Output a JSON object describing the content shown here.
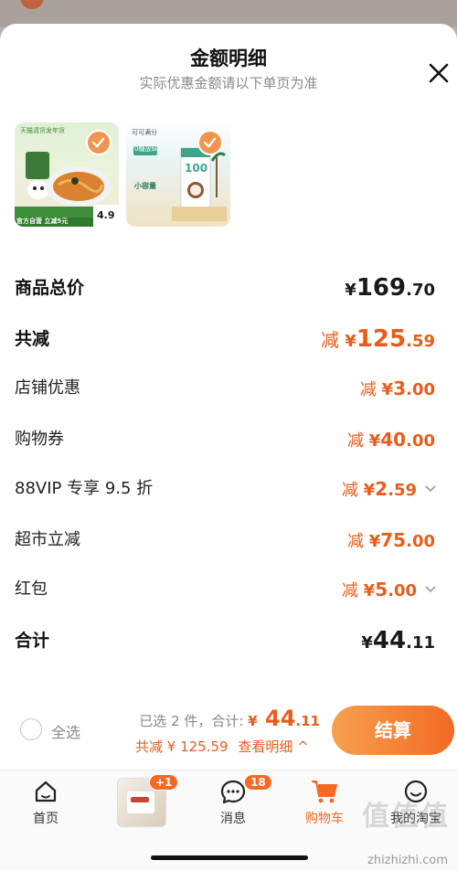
{
  "header": {
    "title": "金额明细",
    "subtitle": "实际优惠金额请以下单页为准"
  },
  "products": [
    {
      "name": "意面",
      "top_text": "天猫清货发年货",
      "price_badge": "4.9",
      "banner": "官方自营 立减5元"
    },
    {
      "name": "无糖椰乳",
      "brand": "可可满分",
      "tag1": "0糖放纵",
      "tag2": "小容量",
      "num": "100"
    }
  ],
  "rows": [
    {
      "label": "商品总价",
      "prefix": "",
      "yen": "¥",
      "int": "169",
      "dec": ".70"
    },
    {
      "label": "共减",
      "prefix": "减 ",
      "yen": "¥",
      "int": "125",
      "dec": ".59"
    },
    {
      "label": "店铺优惠",
      "prefix": "减 ",
      "yen": "¥",
      "int": "3",
      "dec": ".00"
    },
    {
      "label": "购物券",
      "prefix": "减 ",
      "yen": "¥",
      "int": "40",
      "dec": ".00"
    },
    {
      "label": "88VIP 专享 9.5 折",
      "prefix": "减 ",
      "yen": "¥",
      "int": "2",
      "dec": ".59"
    },
    {
      "label": "超市立减",
      "prefix": "减 ",
      "yen": "¥",
      "int": "75",
      "dec": ".00"
    },
    {
      "label": "红包",
      "prefix": "减 ",
      "yen": "¥",
      "int": "5",
      "dec": ".00"
    },
    {
      "label": "合计",
      "prefix": "",
      "yen": "¥",
      "int": "44",
      "dec": ".11"
    }
  ],
  "bottom": {
    "select_all": "全选",
    "selected_text": "已选 2 件，合计:",
    "total_yen": "¥",
    "total_int": "44",
    "total_dec": ".11",
    "discount_text": "共减 ¥ 125.59",
    "detail_link": "查看明细 ^",
    "pay_button": "结算"
  },
  "tabbar": {
    "home": "首页",
    "cart_badge": "+1",
    "messages": "消息",
    "messages_badge": "18",
    "cart": "购物车",
    "mine": "我的淘宝"
  },
  "watermark": {
    "text": "zhizhizhi.com",
    "logo_text": "值值值"
  },
  "colors": {
    "accent": "#e85d1c",
    "button_start": "#f7a04e",
    "button_end": "#f36a24"
  }
}
